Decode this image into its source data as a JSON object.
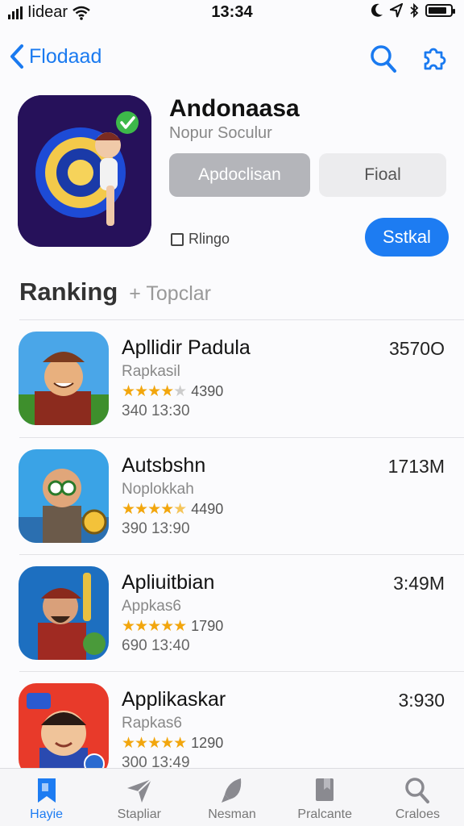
{
  "status": {
    "carrier": "Iidear",
    "time": "13:34"
  },
  "nav": {
    "back_label": "Flodaad"
  },
  "app": {
    "title": "Andonaasa",
    "subtitle": "Nopur Soculur",
    "primary_button": "Apdoclisan",
    "secondary_button": "Fioal",
    "checkbox_label": "Rlingo",
    "action_button": "Sstkal"
  },
  "section": {
    "title": "Ranking",
    "subtitle": "+ Topclar"
  },
  "ranking": [
    {
      "name": "Apllidir Padula",
      "maker": "Rapkasil",
      "rating": 4,
      "rating_text": "4390",
      "meta": "340  13:30",
      "price": "3570O"
    },
    {
      "name": "Autsbshn",
      "maker": "Noplokkah",
      "rating": 4.5,
      "rating_text": "4490",
      "meta": "390  13:90",
      "price": "1713M"
    },
    {
      "name": "Apliuitbian",
      "maker": "Appkas6",
      "rating": 5,
      "rating_text": "1790",
      "meta": "690  13:40",
      "price": "3:49M"
    },
    {
      "name": "Applikaskar",
      "maker": "Rapkas6",
      "rating": 5,
      "rating_text": "1290",
      "meta": "300  13:49",
      "price": "3:930"
    }
  ],
  "tabs": [
    {
      "label": "Hayie",
      "icon": "bookmark-icon",
      "active": true
    },
    {
      "label": "Stapliar",
      "icon": "paper-plane-icon",
      "active": false
    },
    {
      "label": "Nesman",
      "icon": "rocket-icon",
      "active": false
    },
    {
      "label": "Pralcante",
      "icon": "book-icon",
      "active": false
    },
    {
      "label": "Craloes",
      "icon": "search-icon",
      "active": false
    }
  ],
  "colors": {
    "accent": "#1d7cf2",
    "star": "#f2a60d"
  }
}
